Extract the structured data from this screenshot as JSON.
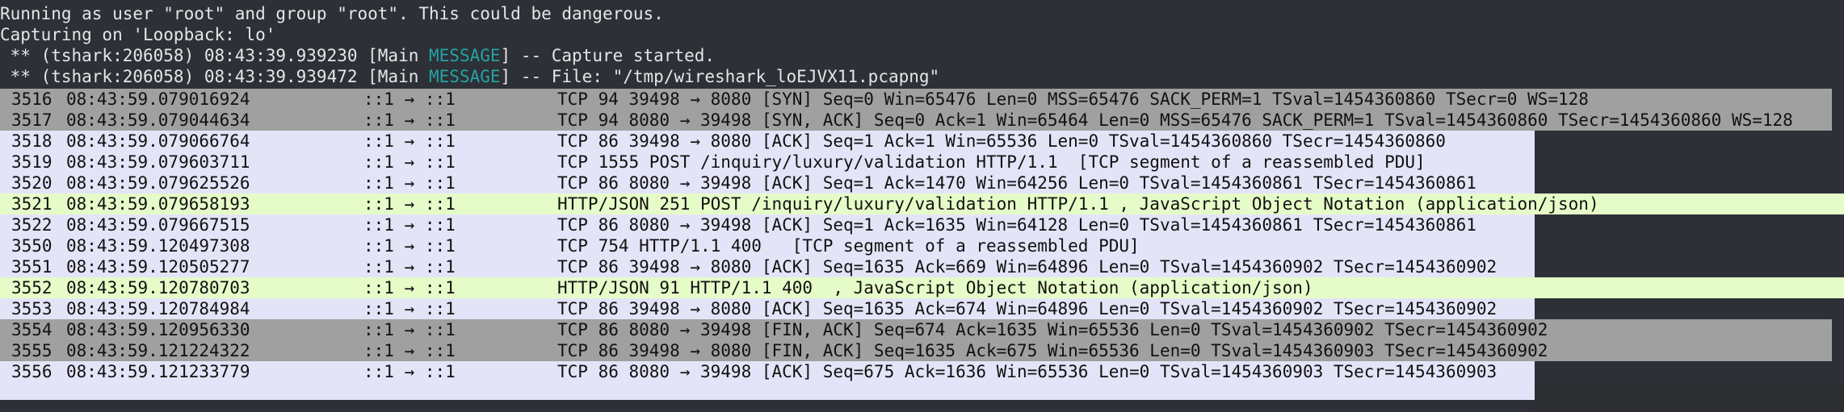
{
  "console": {
    "lines": [
      "Running as user \"root\" and group \"root\". This could be dangerous.",
      "Capturing on 'Loopback: lo'"
    ],
    "msg1": {
      "prefix": " ** (tshark:206058) 08:43:39.939230 [Main ",
      "tag": "MESSAGE",
      "suffix": "] -- Capture started."
    },
    "msg2": {
      "prefix": " ** (tshark:206058) 08:43:39.939472 [Main ",
      "tag": "MESSAGE",
      "suffix": "] -- File: \"/tmp/wireshark_loEJVX11.pcapng\""
    }
  },
  "colors": {
    "terminal_bg": "#2d3037",
    "gray_row": "#a0a0a0",
    "lavender_row": "#e4e4f8",
    "green_row": "#e6fcc8",
    "message_tag": "#24a3a3"
  },
  "packets": [
    {
      "no": "3516",
      "time": "08:43:59.079016924",
      "src": "::1 → ::1",
      "info": "TCP 94 39498 → 8080 [SYN] Seq=0 Win=65476 Len=0 MSS=65476 SACK_PERM=1 TSval=1454360860 TSecr=0 WS=128",
      "style": "gray"
    },
    {
      "no": "3517",
      "time": "08:43:59.079044634",
      "src": "::1 → ::1",
      "info": "TCP 94 8080 → 39498 [SYN, ACK] Seq=0 Ack=1 Win=65464 Len=0 MSS=65476 SACK_PERM=1 TSval=1454360860 TSecr=1454360860 WS=128",
      "style": "gray"
    },
    {
      "no": "3518",
      "time": "08:43:59.079066764",
      "src": "::1 → ::1",
      "info": "TCP 86 39498 → 8080 [ACK] Seq=1 Ack=1 Win=65536 Len=0 TSval=1454360860 TSecr=1454360860",
      "style": "lav"
    },
    {
      "no": "3519",
      "time": "08:43:59.079603711",
      "src": "::1 → ::1",
      "info": "TCP 1555 POST /inquiry/luxury/validation HTTP/1.1  [TCP segment of a reassembled PDU]",
      "style": "lav"
    },
    {
      "no": "3520",
      "time": "08:43:59.079625526",
      "src": "::1 → ::1",
      "info": "TCP 86 8080 → 39498 [ACK] Seq=1 Ack=1470 Win=64256 Len=0 TSval=1454360861 TSecr=1454360861",
      "style": "lav"
    },
    {
      "no": "3521",
      "time": "08:43:59.079658193",
      "src": "::1 → ::1",
      "info": "HTTP/JSON 251 POST /inquiry/luxury/validation HTTP/1.1 , JavaScript Object Notation (application/json)",
      "style": "green"
    },
    {
      "no": "3522",
      "time": "08:43:59.079667515",
      "src": "::1 → ::1",
      "info": "TCP 86 8080 → 39498 [ACK] Seq=1 Ack=1635 Win=64128 Len=0 TSval=1454360861 TSecr=1454360861",
      "style": "lav"
    },
    {
      "no": "3550",
      "time": "08:43:59.120497308",
      "src": "::1 → ::1",
      "info": "TCP 754 HTTP/1.1 400   [TCP segment of a reassembled PDU]",
      "style": "lav"
    },
    {
      "no": "3551",
      "time": "08:43:59.120505277",
      "src": "::1 → ::1",
      "info": "TCP 86 39498 → 8080 [ACK] Seq=1635 Ack=669 Win=64896 Len=0 TSval=1454360902 TSecr=1454360902",
      "style": "lav"
    },
    {
      "no": "3552",
      "time": "08:43:59.120780703",
      "src": "::1 → ::1",
      "info": "HTTP/JSON 91 HTTP/1.1 400  , JavaScript Object Notation (application/json)",
      "style": "green"
    },
    {
      "no": "3553",
      "time": "08:43:59.120784984",
      "src": "::1 → ::1",
      "info": "TCP 86 39498 → 8080 [ACK] Seq=1635 Ack=674 Win=64896 Len=0 TSval=1454360902 TSecr=1454360902",
      "style": "lav"
    },
    {
      "no": "3554",
      "time": "08:43:59.120956330",
      "src": "::1 → ::1",
      "info": "TCP 86 8080 → 39498 [FIN, ACK] Seq=674 Ack=1635 Win=65536 Len=0 TSval=1454360902 TSecr=1454360902",
      "style": "gray"
    },
    {
      "no": "3555",
      "time": "08:43:59.121224322",
      "src": "::1 → ::1",
      "info": "TCP 86 39498 → 8080 [FIN, ACK] Seq=1635 Ack=675 Win=65536 Len=0 TSval=1454360903 TSecr=1454360902",
      "style": "gray"
    },
    {
      "no": "3556",
      "time": "08:43:59.121233779",
      "src": "::1 → ::1",
      "info": "TCP 86 8080 → 39498 [ACK] Seq=675 Ack=1636 Win=65536 Len=0 TSval=1454360903 TSecr=1454360903",
      "style": "lav"
    }
  ]
}
